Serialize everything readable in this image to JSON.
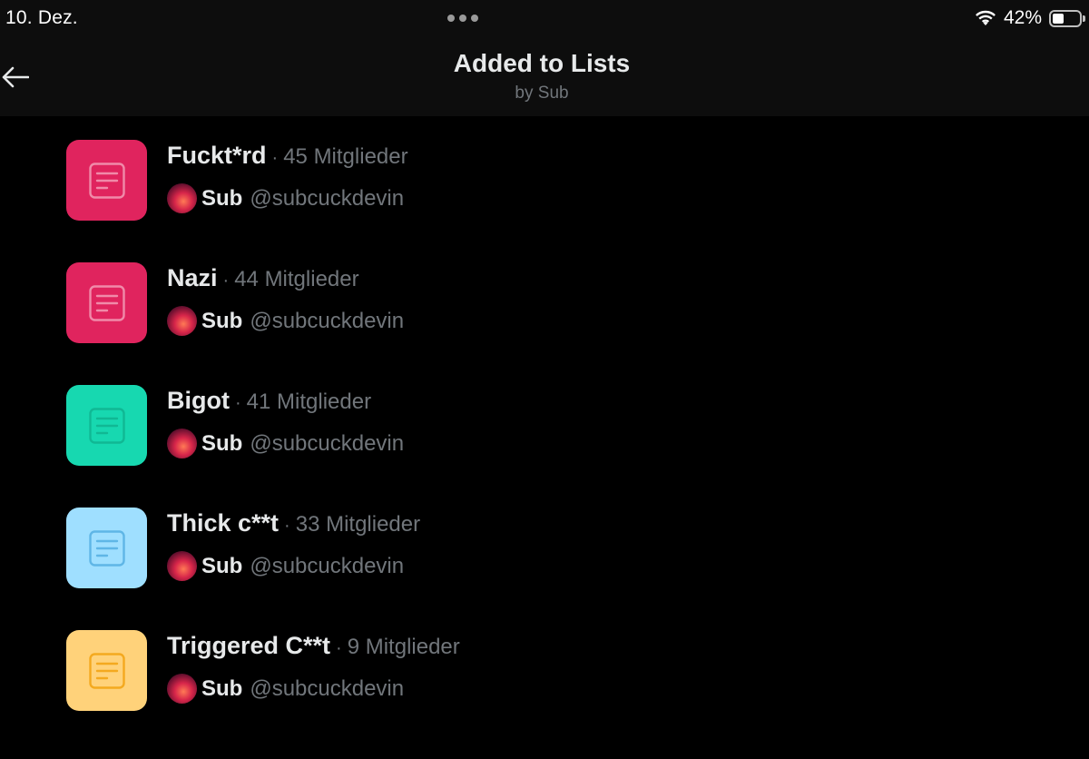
{
  "status_bar": {
    "date": "10. Dez.",
    "battery_percent": "42%",
    "battery_level": 0.42
  },
  "header": {
    "title": "Added to Lists",
    "subtitle": "by Sub"
  },
  "lists": [
    {
      "name": "Fuckt*rd",
      "separator": "·",
      "members": "45 Mitglieder",
      "icon_color": "#e0245e",
      "glyph_color": "#f08aa9",
      "owner_name": "Sub",
      "owner_handle": "@subcuckdevin"
    },
    {
      "name": "Nazi",
      "separator": "·",
      "members": "44 Mitglieder",
      "icon_color": "#e0245e",
      "glyph_color": "#f08aa9",
      "owner_name": "Sub",
      "owner_handle": "@subcuckdevin"
    },
    {
      "name": "Bigot",
      "separator": "·",
      "members": "41 Mitglieder",
      "icon_color": "#17d8b0",
      "glyph_color": "#10b894",
      "owner_name": "Sub",
      "owner_handle": "@subcuckdevin"
    },
    {
      "name": "Thick c**t",
      "separator": "·",
      "members": "33 Mitglieder",
      "icon_color": "#9fdfff",
      "glyph_color": "#5fb6e6",
      "owner_name": "Sub",
      "owner_handle": "@subcuckdevin"
    },
    {
      "name": "Triggered C**t",
      "separator": "·",
      "members": "9 Mitglieder",
      "icon_color": "#ffd27a",
      "glyph_color": "#f4a91f",
      "owner_name": "Sub",
      "owner_handle": "@subcuckdevin"
    }
  ]
}
